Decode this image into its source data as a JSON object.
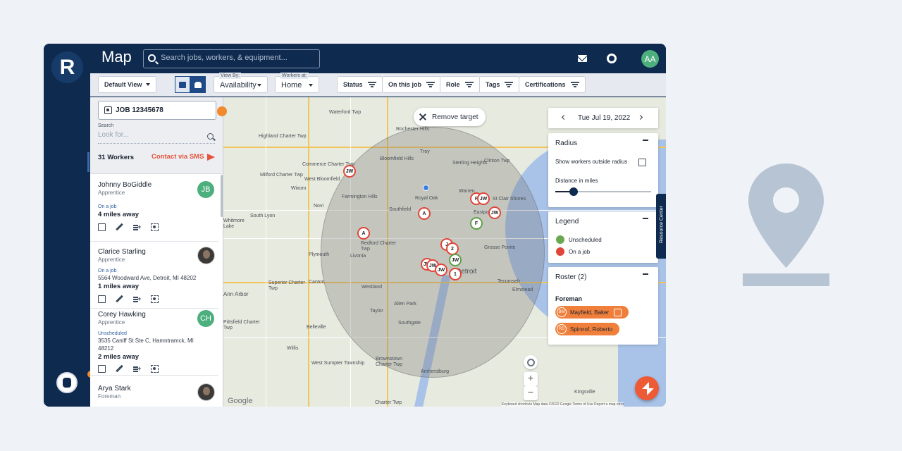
{
  "app": {
    "logo_letter": "R",
    "title": "Map",
    "search_placeholder": "Search jobs, workers, & equipment...",
    "user_initials": "AA"
  },
  "toolbar": {
    "default_view": "Default View",
    "view_by_caption": "View By:",
    "view_by_value": "Availability",
    "workers_at_caption": "Workers at:",
    "workers_at_value": "Home",
    "filters": [
      "Status",
      "On this job",
      "Role",
      "Tags",
      "Certifications"
    ]
  },
  "panel": {
    "job": "JOB 12345678",
    "search_label": "Search",
    "search_placeholder": "Look for...",
    "worker_count": "31 Workers",
    "sms_label": "Contact via SMS"
  },
  "workers": [
    {
      "name": "Johnny BoGiddle",
      "role": "Apprentice",
      "initials": "JB",
      "status": "On a job",
      "address": "",
      "distance": "4 miles away"
    },
    {
      "name": "Clarice Starling",
      "role": "Apprentice",
      "initials": "",
      "status": "On a job",
      "address": "5564 Woodward Ave, Detroit, MI 48202",
      "distance": "1 miles away"
    },
    {
      "name": "Corey Hawking",
      "role": "Apprentice",
      "initials": "CH",
      "status": "Unscheduled",
      "address": "3535 Caniff St Ste C, Hamntramck, MI 48212",
      "distance": "2 miles away"
    },
    {
      "name": "Arya Stark",
      "role": "Foreman",
      "initials": "",
      "status": "",
      "address": "",
      "distance": ""
    }
  ],
  "map": {
    "remove_target": "Remove target",
    "towns": [
      "Waterford Twp",
      "Rochester Hills",
      "Highland Charter Twp",
      "Bloomfield Hills",
      "Troy",
      "Sterling Heights",
      "Clinton Twp",
      "Commerce Charter Twp",
      "Milford Charter Twp",
      "West Bloomfield",
      "Farmington Hills",
      "Southfield",
      "Royal Oak",
      "Warren",
      "St Clair Shores",
      "Wixom",
      "Novi",
      "South Lyon",
      "Eastpointe",
      "Grosse Pointe",
      "Redford Charter Twp",
      "Plymouth",
      "Livonia",
      "Canton",
      "Superior Charter Twp",
      "Westland",
      "Ann Arbor",
      "Taylor",
      "Allen Park",
      "Tecumseh",
      "Elmstead",
      "Pittsfield Charter Twp",
      "Belleville",
      "Southgate",
      "Willis",
      "West Sumpter Township",
      "Brownstown Charter Twp",
      "Amherstburg",
      "Kingsville",
      "Charter Twp",
      "Whitmore Lake",
      "Detroit"
    ],
    "zoom_in": "+",
    "zoom_out": "−",
    "google": "Google",
    "attribution": "Keyboard shortcuts   Map data ©2022 Google   Terms of Use   Report a map error"
  },
  "right_panel": {
    "date": "Tue Jul 19, 2022",
    "radius_title": "Radius",
    "show_outside": "Show workers outside radius",
    "distance_label": "Distance in miles",
    "radius_value_fraction": 0.19,
    "legend_title": "Legend",
    "legend": [
      {
        "label": "Unscheduled",
        "color": "#6aa84f"
      },
      {
        "label": "On a job",
        "color": "#e0453a"
      }
    ],
    "roster_title": "Roster (2)",
    "roster_group": "Foreman",
    "roster": [
      {
        "initials": "BM",
        "name": "Mayfield, Baker"
      },
      {
        "initials": "RS",
        "name": "Spinnof, Roberto"
      }
    ],
    "resource_center": "Resource Center"
  },
  "colors": {
    "navy": "#0e2a4f",
    "accent": "#ef7f3a",
    "danger": "#e5533b",
    "green": "#4caf7d"
  }
}
